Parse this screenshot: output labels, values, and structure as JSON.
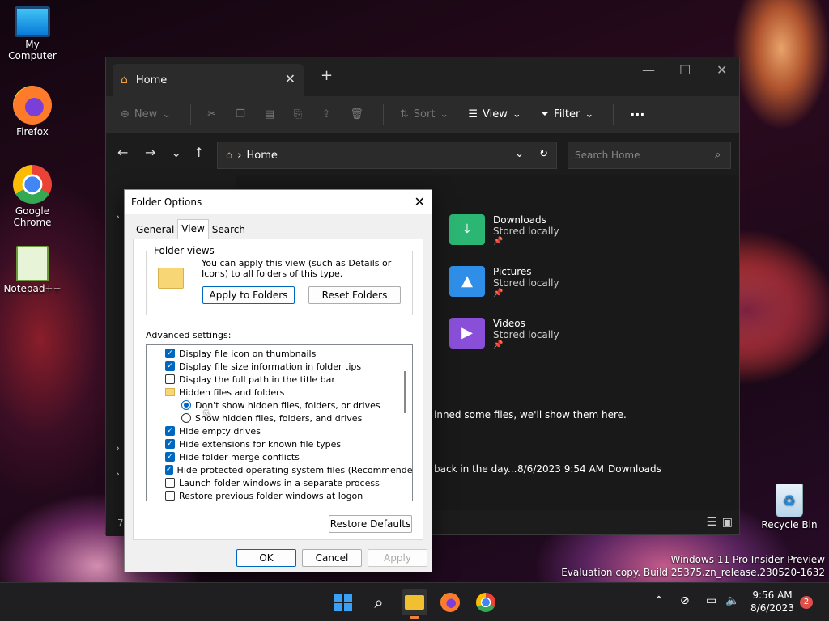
{
  "desktop": {
    "icons": [
      {
        "label": "My Computer"
      },
      {
        "label": "Firefox"
      },
      {
        "label": "Google Chrome"
      },
      {
        "label": "Notepad++"
      },
      {
        "label": "Recycle Bin"
      }
    ]
  },
  "explorer": {
    "tab_title": "Home",
    "commands": {
      "new": "New",
      "sort": "Sort",
      "view": "View",
      "filter": "Filter"
    },
    "address": "Home",
    "search_placeholder": "Search Home",
    "folders": [
      {
        "name": "Downloads",
        "sub": "Stored locally",
        "color": "#2bb673"
      },
      {
        "name": "Pictures",
        "sub": "Stored locally",
        "color": "#2f8fe8"
      },
      {
        "name": "Videos",
        "sub": "Stored locally",
        "color": "#8a4fd8"
      }
    ],
    "pinned_msg": "inned some files, we'll show them here.",
    "recent": {
      "name": "back in the day...",
      "date": "8/6/2023 9:54 AM",
      "location": "Downloads"
    },
    "status_count": "7"
  },
  "dialog": {
    "title": "Folder Options",
    "tabs": [
      "General",
      "View",
      "Search"
    ],
    "folder_views_label": "Folder views",
    "folder_views_text": "You can apply this view (such as Details or Icons) to all folders of this type.",
    "apply_btn": "Apply to Folders",
    "reset_btn": "Reset Folders",
    "advanced_label": "Advanced settings:",
    "settings": [
      {
        "type": "check",
        "checked": true,
        "label": "Display file icon on thumbnails"
      },
      {
        "type": "check",
        "checked": true,
        "label": "Display file size information in folder tips"
      },
      {
        "type": "check",
        "checked": false,
        "label": "Display the full path in the title bar"
      },
      {
        "type": "folder",
        "label": "Hidden files and folders"
      },
      {
        "type": "radio",
        "checked": true,
        "label": "Don't show hidden files, folders, or drives"
      },
      {
        "type": "radio",
        "checked": false,
        "label": "Show hidden files, folders, and drives"
      },
      {
        "type": "check",
        "checked": true,
        "label": "Hide empty drives"
      },
      {
        "type": "check",
        "checked": true,
        "label": "Hide extensions for known file types"
      },
      {
        "type": "check",
        "checked": true,
        "label": "Hide folder merge conflicts"
      },
      {
        "type": "check",
        "checked": true,
        "label": "Hide protected operating system files (Recommended)"
      },
      {
        "type": "check",
        "checked": false,
        "label": "Launch folder windows in a separate process"
      },
      {
        "type": "check",
        "checked": false,
        "label": "Restore previous folder windows at logon"
      }
    ],
    "restore_btn": "Restore Defaults",
    "ok": "OK",
    "cancel": "Cancel",
    "apply": "Apply"
  },
  "watermark": {
    "line1": "Windows 11 Pro Insider Preview",
    "line2": "Evaluation copy. Build 25375.zn_release.230520-1632"
  },
  "taskbar": {
    "time": "9:56 AM",
    "date": "8/6/2023",
    "notifications": "2"
  }
}
